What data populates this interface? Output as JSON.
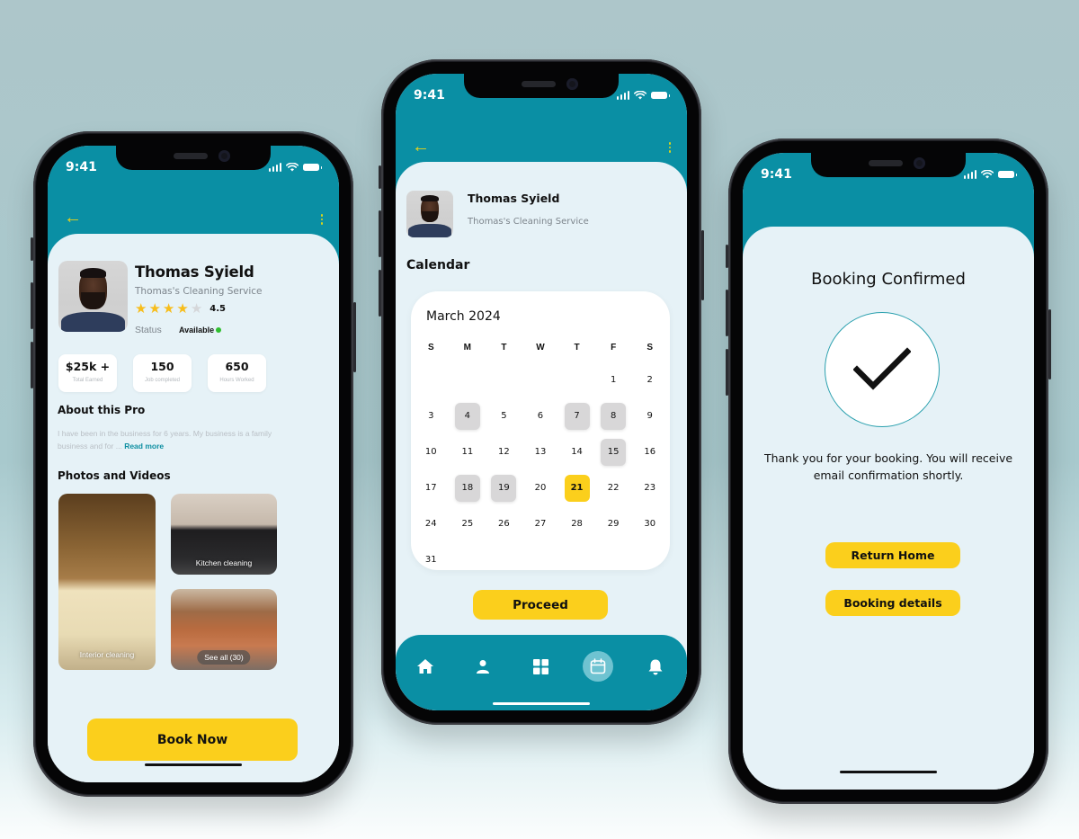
{
  "status_bar": {
    "time": "9:41"
  },
  "profile": {
    "name": "Thomas Syield",
    "service": "Thomas's Cleaning Service",
    "rating": {
      "value": "4.5",
      "stars_filled": 4,
      "stars_total": 5
    },
    "status_label": "Status",
    "status_value": "Available",
    "status_color": "#2fbf2f",
    "stats": [
      {
        "value": "$25k +",
        "label": "Total Earned"
      },
      {
        "value": "150",
        "label": "Job completed"
      },
      {
        "value": "650",
        "label": "Hours Worked"
      }
    ],
    "about_title": "About this Pro",
    "about_text": "I have been in the business for 6 years. My business is a family business and for ... ",
    "read_more": "Read more",
    "photos_title": "Photos and Videos",
    "photos": [
      {
        "caption": "Interior cleaning"
      },
      {
        "caption": "Kitchen cleaning"
      },
      {
        "caption": "See all (30)"
      }
    ],
    "book_button": "Book Now"
  },
  "calendar_screen": {
    "name": "Thomas Syield",
    "service": "Thomas's Cleaning Service",
    "section_title": "Calendar",
    "month": "March 2024",
    "weekdays": [
      "S",
      "M",
      "T",
      "W",
      "T",
      "F",
      "S"
    ],
    "first_weekday_index": 5,
    "days_in_month": 31,
    "unavailable_days": [
      4,
      7,
      8,
      15,
      18,
      19
    ],
    "selected_day": 21,
    "proceed_button": "Proceed",
    "nav": [
      {
        "icon": "home-icon",
        "label": "Home"
      },
      {
        "icon": "user-icon",
        "label": "Profile"
      },
      {
        "icon": "grid-icon",
        "label": "Categories"
      },
      {
        "icon": "calendar-icon",
        "label": "Calendar",
        "active": true
      },
      {
        "icon": "bell-icon",
        "label": "Notifications"
      }
    ]
  },
  "confirmation": {
    "title": "Booking Confirmed",
    "message": "Thank you for your booking. You will receive email confirmation shortly.",
    "return_home_button": "Return Home",
    "booking_details_button": "Booking details"
  },
  "colors": {
    "brand_teal": "#0a8fa4",
    "accent_yellow": "#fbcf1c",
    "sheet_bg": "#e6f2f7",
    "busy_day": "#d8d7d8"
  }
}
